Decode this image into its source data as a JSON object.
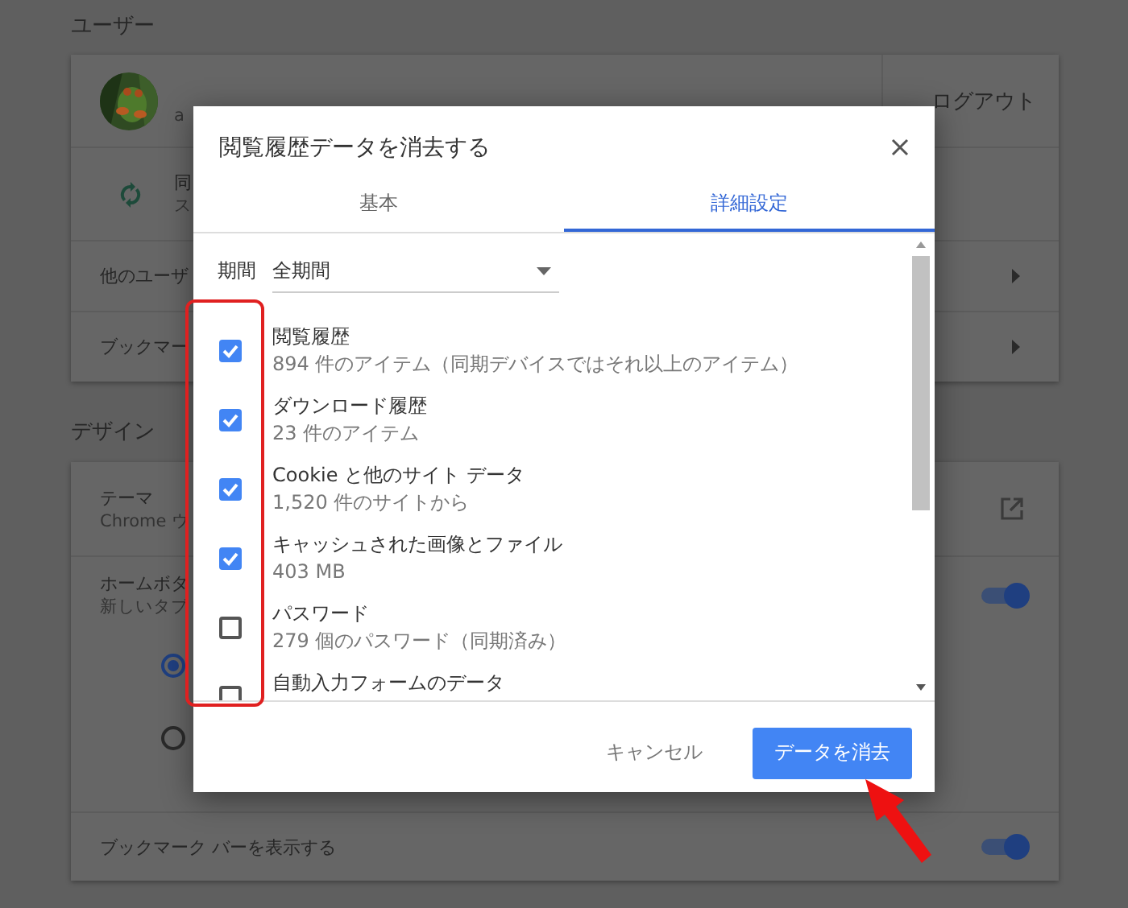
{
  "settings": {
    "sections": [
      {
        "title": "ユーザー",
        "rows": [
          {
            "kind": "profile",
            "subtitle": "a",
            "action": "ログアウト"
          },
          {
            "kind": "sync",
            "title": "同",
            "subtitle": "ス"
          },
          {
            "kind": "link",
            "title": "他のユーザ"
          },
          {
            "kind": "link",
            "title": "ブックマー"
          }
        ]
      },
      {
        "title": "デザイン",
        "rows": [
          {
            "kind": "external",
            "title": "テーマ",
            "subtitle": "Chrome ウ"
          },
          {
            "kind": "home",
            "title": "ホームボタ",
            "subtitle": "新しいタブ",
            "on": true,
            "options": [
              {
                "selected": true
              },
              {
                "selected": false
              }
            ]
          },
          {
            "kind": "toggle",
            "title": "ブックマーク バーを表示する",
            "on": true
          }
        ]
      }
    ]
  },
  "dialog": {
    "title": "閲覧履歴データを消去する",
    "tabs": [
      {
        "label": "基本",
        "selected": false
      },
      {
        "label": "詳細設定",
        "selected": true
      }
    ],
    "period": {
      "label": "期間",
      "value": "全期間"
    },
    "items": [
      {
        "title": "閲覧履歴",
        "detail": "894 件のアイテム（同期デバイスではそれ以上のアイテム）",
        "checked": true
      },
      {
        "title": "ダウンロード履歴",
        "detail": "23 件のアイテム",
        "checked": true
      },
      {
        "title": "Cookie と他のサイト データ",
        "detail": "1,520 件のサイトから",
        "checked": true
      },
      {
        "title": "キャッシュされた画像とファイル",
        "detail": "403 MB",
        "checked": true
      },
      {
        "title": "パスワード",
        "detail": "279 個のパスワード（同期済み）",
        "checked": false
      },
      {
        "title": "自動入力フォームのデータ",
        "checked": false
      }
    ],
    "cancel": "キャンセル",
    "confirm": "データを消去"
  }
}
